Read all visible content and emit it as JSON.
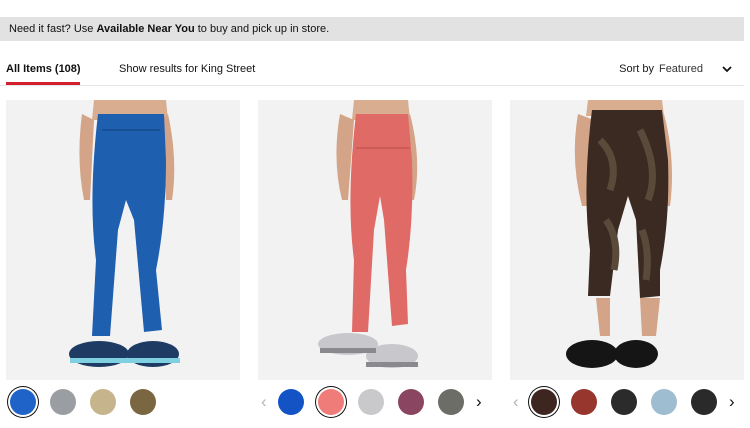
{
  "banner": {
    "prefix": "Need it fast? Use ",
    "highlight": "Available Near You",
    "suffix": " to buy and pick up in store."
  },
  "tabs": {
    "all_items": "All Items (108)",
    "store_results": "Show results for King Street"
  },
  "sort": {
    "label": "Sort by",
    "value": "Featured"
  },
  "products": [
    {
      "legging_color": "#1f5fb0",
      "shoe_color": "#1d3b63",
      "swatches": [
        "#1f63c8",
        "#9a9ea3",
        "#c6b58c",
        "#7a6640"
      ],
      "selected_index": 0
    },
    {
      "legging_color": "#e06a66",
      "shoe_color": "#c8c8cc",
      "swatches": [
        "#1453c6",
        "#ef7c78",
        "#c9c9cc",
        "#8a4660",
        "#6c6d66"
      ],
      "selected_index": 1
    },
    {
      "legging_color": "#3a2a22",
      "shoe_color": "#151515",
      "swatches": [
        "#3d2620",
        "#96362d",
        "#2b2b2b",
        "#9fbdd0",
        "#2a2a2a"
      ],
      "selected_index": 0
    }
  ],
  "colors": {
    "accent": "#d31f2d",
    "banner_bg": "#e2e2e2",
    "photo_bg": "#f2f2f2"
  }
}
